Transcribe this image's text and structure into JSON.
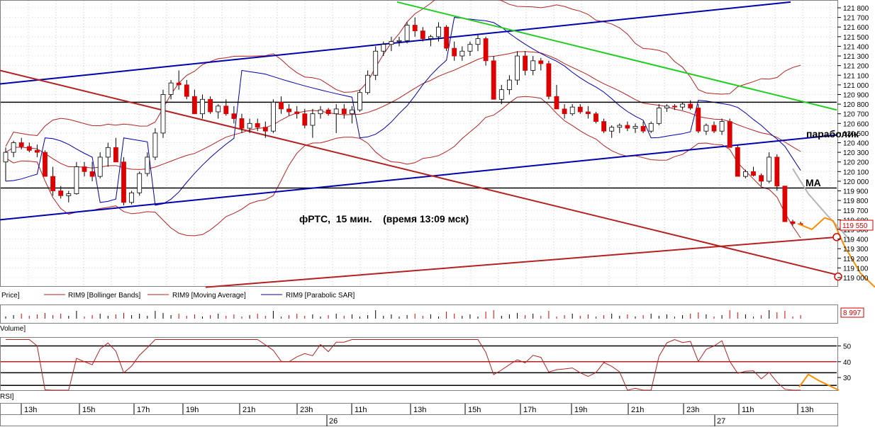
{
  "chart_data": {
    "type": "candlestick",
    "instrument": "RIM9",
    "annotation": "фРТС,  15 мин.    (время 13:09 мск)",
    "labels": {
      "parabolic": "параболик",
      "ma": "MA"
    },
    "price_axis": {
      "ylim": [
        118900,
        121850
      ],
      "ticks": [
        121800,
        121700,
        121600,
        121500,
        121400,
        121300,
        121200,
        121100,
        121000,
        120900,
        120800,
        120700,
        120600,
        120500,
        120400,
        120300,
        120200,
        120100,
        120000,
        119900,
        119800,
        119700,
        119600,
        119500,
        119400,
        119300,
        119200,
        119100,
        119000
      ],
      "tick_labels": [
        "121 800",
        "121 700",
        "121 600",
        "121 500",
        "121 400",
        "121 300",
        "121 200",
        "121 100",
        "121 000",
        "120 900",
        "120 800",
        "120 700",
        "120 600",
        "120 500",
        "120 400",
        "120 300",
        "120 200",
        "120 100",
        "120 000",
        "119 900",
        "119 800",
        "119 700",
        "119 600",
        "119 500",
        "119 400",
        "119 300",
        "119 200",
        "119 100",
        "119 000"
      ],
      "last_price_label": "119 550",
      "current_price": 119550
    },
    "horizontal_levels": [
      120820,
      119930
    ],
    "trend_lines": [
      {
        "color": "#0000aa",
        "from": [
          0,
          121010
        ],
        "to": [
          1115,
          121860
        ]
      },
      {
        "color": "#0000aa",
        "from": [
          0,
          119600
        ],
        "to": [
          1180,
          120480
        ]
      },
      {
        "color": "#22cc22",
        "from": [
          560,
          121860
        ],
        "to": [
          1180,
          120740
        ]
      },
      {
        "color": "#b22222",
        "from": [
          0,
          121150
        ],
        "to": [
          1180,
          119030
        ]
      },
      {
        "color": "#b22222",
        "from": [
          290,
          118900
        ],
        "to": [
          1180,
          119420
        ]
      }
    ],
    "forecast_gray": [
      [
        1118,
        120130
      ],
      [
        1140,
        119870
      ],
      [
        1165,
        119660
      ],
      [
        1200,
        119380
      ]
    ],
    "forecast_orange": [
      [
        1125,
        119560
      ],
      [
        1145,
        119500
      ],
      [
        1163,
        119620
      ],
      [
        1175,
        119590
      ],
      [
        1190,
        119340
      ],
      [
        1213,
        119050
      ],
      [
        1234,
        118900
      ]
    ],
    "target_circles": [
      [
        1180,
        119420
      ],
      [
        1182,
        119010
      ]
    ],
    "candles": [
      [
        120200,
        120350,
        120000,
        120300
      ],
      [
        120300,
        120420,
        120250,
        120400
      ],
      [
        120400,
        120450,
        120330,
        120360
      ],
      [
        120360,
        120400,
        120300,
        120320
      ],
      [
        120320,
        120380,
        120250,
        120300
      ],
      [
        120300,
        120320,
        120050,
        120050
      ],
      [
        120050,
        120150,
        119850,
        119900
      ],
      [
        119900,
        119950,
        119820,
        119850
      ],
      [
        119850,
        119900,
        119780,
        119870
      ],
      [
        119870,
        120200,
        119860,
        120150
      ],
      [
        120150,
        120200,
        120050,
        120100
      ],
      [
        120100,
        120200,
        120000,
        120050
      ],
      [
        120050,
        120300,
        120030,
        120250
      ],
      [
        120250,
        120400,
        120150,
        120350
      ],
      [
        120350,
        120450,
        120200,
        120200
      ],
      [
        120200,
        120250,
        119750,
        119780
      ],
      [
        119780,
        119900,
        119760,
        119880
      ],
      [
        119880,
        120100,
        119850,
        120080
      ],
      [
        120080,
        120300,
        120050,
        120250
      ],
      [
        120250,
        120550,
        120220,
        120500
      ],
      [
        120500,
        120950,
        120450,
        120900
      ],
      [
        120900,
        121050,
        120850,
        121020
      ],
      [
        121020,
        121150,
        120950,
        121000
      ],
      [
        121000,
        121050,
        120850,
        120880
      ],
      [
        120880,
        120950,
        120700,
        120700
      ],
      [
        120700,
        120900,
        120650,
        120850
      ],
      [
        120850,
        120880,
        120700,
        120720
      ],
      [
        120720,
        120800,
        120650,
        120780
      ],
      [
        120780,
        120850,
        120680,
        120700
      ],
      [
        120700,
        120780,
        120600,
        120650
      ],
      [
        120650,
        120700,
        120500,
        120550
      ],
      [
        120550,
        120650,
        120500,
        120600
      ],
      [
        120600,
        120650,
        120520,
        120560
      ],
      [
        120560,
        120620,
        120450,
        120520
      ],
      [
        120520,
        120850,
        120500,
        120820
      ],
      [
        120820,
        120880,
        120700,
        120750
      ],
      [
        120750,
        120800,
        120680,
        120720
      ],
      [
        120720,
        120780,
        120650,
        120700
      ],
      [
        120700,
        120750,
        120550,
        120580
      ],
      [
        120580,
        120750,
        120450,
        120700
      ],
      [
        120700,
        120780,
        120650,
        120740
      ],
      [
        120740,
        120760,
        120680,
        120700
      ],
      [
        120700,
        120800,
        120500,
        120750
      ],
      [
        120750,
        120800,
        120650,
        120700
      ],
      [
        120700,
        120780,
        120600,
        120740
      ],
      [
        120740,
        120950,
        120720,
        120920
      ],
      [
        120920,
        121150,
        120900,
        121100
      ],
      [
        121100,
        121400,
        121050,
        121350
      ],
      [
        121350,
        121450,
        121300,
        121420
      ],
      [
        121420,
        121500,
        121350,
        121450
      ],
      [
        121450,
        121500,
        121400,
        121460
      ],
      [
        121460,
        121650,
        121430,
        121620
      ],
      [
        121620,
        121700,
        121500,
        121560
      ],
      [
        121560,
        121600,
        121450,
        121480
      ],
      [
        121480,
        121520,
        121400,
        121500
      ],
      [
        121500,
        121650,
        121450,
        121600
      ],
      [
        121600,
        121620,
        121350,
        121380
      ],
      [
        121380,
        121450,
        121250,
        121300
      ],
      [
        121300,
        121400,
        121250,
        121350
      ],
      [
        121350,
        121450,
        121300,
        121420
      ],
      [
        121420,
        121520,
        121350,
        121480
      ],
      [
        121480,
        121500,
        121200,
        121250
      ],
      [
        121250,
        121300,
        120850,
        120850
      ],
      [
        120850,
        121000,
        120800,
        120950
      ],
      [
        120950,
        121100,
        120900,
        121050
      ],
      [
        121050,
        121350,
        121000,
        121300
      ],
      [
        121300,
        121350,
        121100,
        121150
      ],
      [
        121150,
        121300,
        121100,
        121250
      ],
      [
        121250,
        121280,
        121150,
        121220
      ],
      [
        121220,
        121250,
        120850,
        120880
      ],
      [
        120880,
        121000,
        120750,
        120750
      ],
      [
        120750,
        120800,
        120650,
        120700
      ],
      [
        120700,
        120800,
        120680,
        120770
      ],
      [
        120770,
        120800,
        120700,
        120720
      ],
      [
        120720,
        120780,
        120650,
        120700
      ],
      [
        120700,
        120720,
        120600,
        120620
      ],
      [
        120620,
        120650,
        120500,
        120520
      ],
      [
        120520,
        120580,
        120450,
        120560
      ],
      [
        120560,
        120600,
        120500,
        120580
      ],
      [
        120580,
        120620,
        120520,
        120550
      ],
      [
        120550,
        120600,
        120500,
        120570
      ],
      [
        120570,
        120620,
        120500,
        120520
      ],
      [
        120520,
        120620,
        120500,
        120600
      ],
      [
        120600,
        120800,
        120580,
        120760
      ],
      [
        120760,
        120800,
        120720,
        120780
      ],
      [
        120780,
        120800,
        120740,
        120770
      ],
      [
        120770,
        120820,
        120740,
        120800
      ],
      [
        120800,
        120840,
        120740,
        120760
      ],
      [
        120760,
        120800,
        120500,
        120520
      ],
      [
        120520,
        120600,
        120480,
        120580
      ],
      [
        120580,
        120620,
        120500,
        120520
      ],
      [
        120520,
        120650,
        120480,
        120620
      ],
      [
        120620,
        120650,
        120350,
        120350
      ],
      [
        120350,
        120380,
        120050,
        120050
      ],
      [
        120050,
        120120,
        120030,
        120100
      ],
      [
        120100,
        120150,
        120050,
        120060
      ],
      [
        120060,
        120080,
        119950,
        120000
      ],
      [
        120000,
        120300,
        119980,
        120250
      ],
      [
        120250,
        120280,
        119900,
        119950
      ],
      [
        119950,
        119950,
        119580,
        119580
      ],
      [
        119580,
        119600,
        119540,
        119560
      ],
      [
        119560,
        119580,
        119540,
        119550
      ]
    ],
    "legend": [
      {
        "text": "Price]",
        "color": "#000000"
      },
      {
        "text": "RIM9 [Bollinger Bands]",
        "color": "#b22222"
      },
      {
        "text": "RIM9 [Moving Average]",
        "color": "#b22222"
      },
      {
        "text": "RIM9 [Parabolic SAR]",
        "color": "#0000aa"
      }
    ],
    "volume": {
      "label": "Volume]",
      "last_label": "8 997"
    },
    "rsi": {
      "label": "RSI]",
      "ylim": [
        22,
        52
      ],
      "ticks": [
        50,
        40,
        30
      ],
      "levels_black": [
        50,
        33,
        25
      ],
      "level_red": 40,
      "forecast_orange": [
        [
          1127,
          24
        ],
        [
          1140,
          32
        ],
        [
          1155,
          28
        ],
        [
          1183,
          22
        ]
      ]
    },
    "time_axis": {
      "hour_labels": [
        {
          "label": "13h",
          "x": 42
        },
        {
          "label": "15h",
          "x": 124
        },
        {
          "label": "17h",
          "x": 201
        },
        {
          "label": "19h",
          "x": 270
        },
        {
          "label": "21h",
          "x": 350
        },
        {
          "label": "23h",
          "x": 431
        },
        {
          "label": "11h",
          "x": 508
        },
        {
          "label": "13h",
          "x": 591
        },
        {
          "label": "15h",
          "x": 668
        },
        {
          "label": "17h",
          "x": 746
        },
        {
          "label": "19h",
          "x": 818
        },
        {
          "label": "21h",
          "x": 898
        },
        {
          "label": "23h",
          "x": 976
        },
        {
          "label": "11h",
          "x": 1054
        },
        {
          "label": "13h",
          "x": 1137
        }
      ],
      "day_labels": [
        {
          "label": "26",
          "x": 466
        },
        {
          "label": "27",
          "x": 1013
        }
      ]
    }
  }
}
